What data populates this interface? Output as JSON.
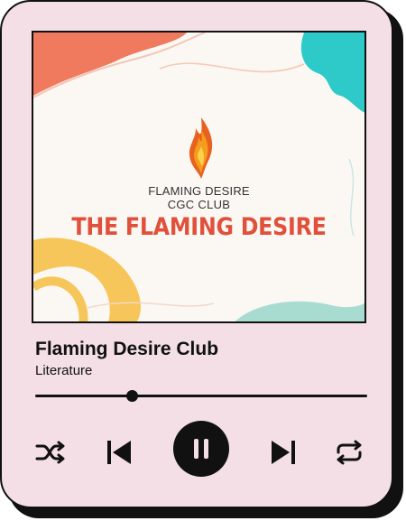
{
  "album_art": {
    "org_line1": "FLAMING DESIRE",
    "org_line2": "CGC CLUB",
    "banner": "THE FLAMING DESIRE"
  },
  "track": {
    "title": "Flaming Desire Club",
    "artist": "Literature"
  },
  "player": {
    "progress_fraction": 0.29,
    "state": "playing"
  },
  "controls": [
    "shuffle-icon",
    "previous-icon",
    "pause-icon",
    "next-icon",
    "repeat-icon"
  ],
  "colors": {
    "card": "#f3dfe5",
    "banner_red": "#e0503a",
    "coral": "#f07a5e",
    "teal": "#2ec9c9",
    "yellow": "#f7c65a",
    "mint": "#a8dcd1"
  }
}
